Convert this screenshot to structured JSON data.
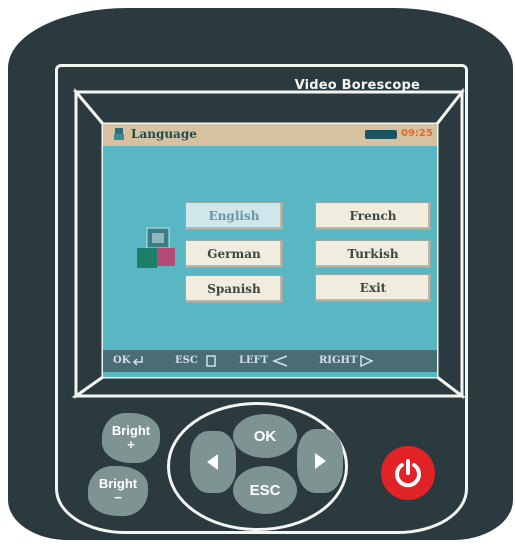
{
  "device": {
    "brand_label": "Video Borescope"
  },
  "screen": {
    "title": "Language",
    "battery_text": "09:25",
    "language_buttons": [
      {
        "label": "English",
        "selected": true
      },
      {
        "label": "French",
        "selected": false
      },
      {
        "label": "German",
        "selected": false
      },
      {
        "label": "Turkish",
        "selected": false
      },
      {
        "label": "Spanish",
        "selected": false
      },
      {
        "label": "Exit",
        "selected": false
      }
    ],
    "status_bar": {
      "ok_label": "OK",
      "esc_label": "ESC",
      "left_label": "LEFT",
      "right_label": "RIGHT"
    }
  },
  "keypad": {
    "ok_label": "OK",
    "esc_label": "ESC",
    "bright_plus_label": "Bright",
    "bright_plus_sign": "+",
    "bright_minus_label": "Bright",
    "bright_minus_sign": "−"
  },
  "colors": {
    "body": "#2b3a3f",
    "screen_bg": "#58b7c2",
    "button_gray": "#7d9493",
    "power_red": "#e12226"
  }
}
